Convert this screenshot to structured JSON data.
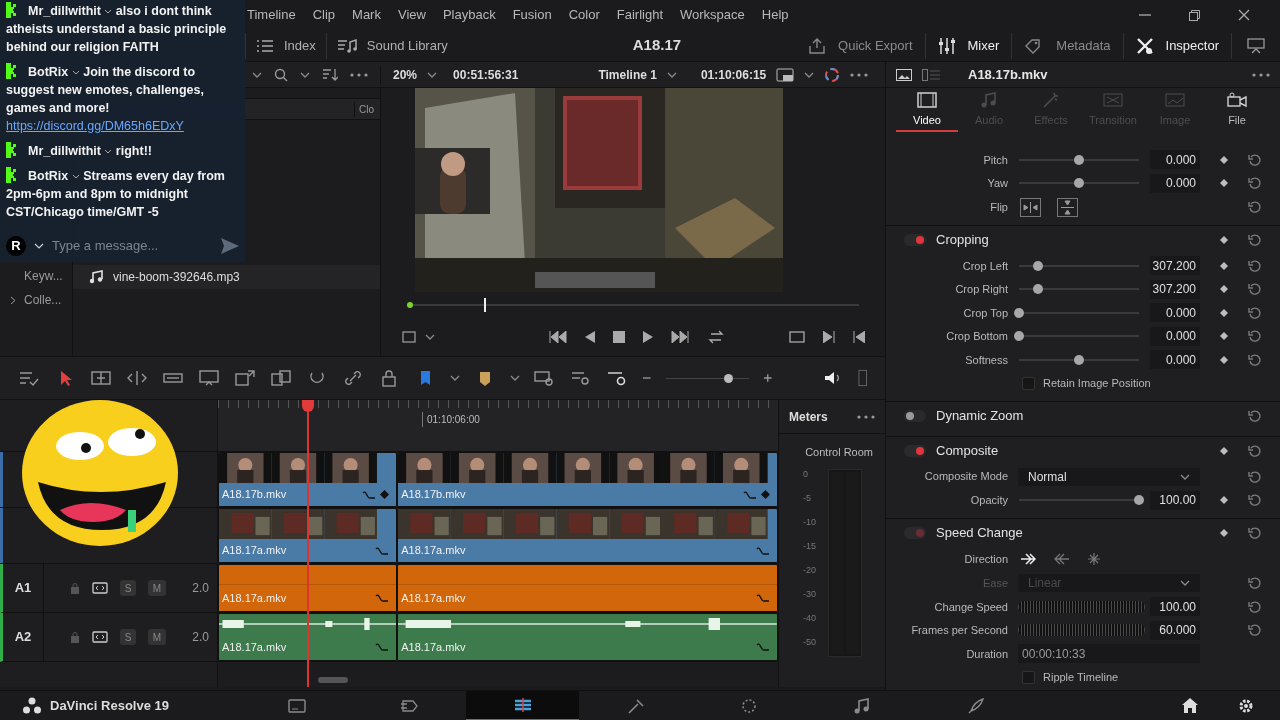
{
  "chat": {
    "messages": [
      {
        "user": "Mr_dillwithit",
        "text": "also i dont think atheists understand a basic principle behind our religion FAITH"
      },
      {
        "user": "BotRix",
        "text": "Join the discord to suggest new emotes, challenges, games and more!",
        "link": "https://discord.gg/DM65h6EDxY"
      },
      {
        "user": "Mr_dillwithit",
        "text": "right!!"
      },
      {
        "user": "BotRix",
        "text": "Streams every day from 2pm-6pm and 8pm to midnight CST/Chicago time/GMT -5"
      }
    ],
    "avatar": "R",
    "placeholder": "Type a message..."
  },
  "menu": [
    "Timeline",
    "Clip",
    "Mark",
    "View",
    "Playback",
    "Fusion",
    "Color",
    "Fairlight",
    "Workspace",
    "Help"
  ],
  "toolbar": {
    "left": [
      {
        "kind": "index",
        "label": "Index"
      },
      {
        "kind": "sound",
        "label": "Sound Library"
      }
    ],
    "project": "A18.17",
    "right": [
      {
        "kind": "export",
        "label": "Quick Export",
        "selected": false
      },
      {
        "kind": "mixer",
        "label": "Mixer",
        "selected": true
      },
      {
        "kind": "metadata",
        "label": "Metadata",
        "selected": false
      },
      {
        "kind": "inspector",
        "label": "Inspector",
        "selected": true
      }
    ]
  },
  "media_pool": {
    "column_header": "Clo",
    "items": [
      {
        "kind": "audio",
        "name": "vine-boom-392646.mp3"
      }
    ],
    "bins": [
      {
        "label": "Keyw...",
        "expandable": false
      },
      {
        "label": "Colle...",
        "expandable": true
      }
    ]
  },
  "viewer": {
    "zoom": "20%",
    "source_timecode": "00:51:56:31",
    "timeline": "Timeline 1",
    "timecode": "01:10:06:15",
    "level": 0.17
  },
  "inspector": {
    "clip": "A18.17b.mkv",
    "tabs": [
      {
        "label": "Video",
        "selected": true,
        "disabled": false
      },
      {
        "label": "Audio",
        "selected": false,
        "disabled": true
      },
      {
        "label": "Effects",
        "selected": false,
        "disabled": true
      },
      {
        "label": "Transition",
        "selected": false,
        "disabled": true
      },
      {
        "label": "Image",
        "selected": false,
        "disabled": true
      },
      {
        "label": "File",
        "selected": false,
        "disabled": false
      }
    ],
    "rows": [
      {
        "kind": "slider",
        "label": "Pitch",
        "level": 0.5,
        "value": "0.000",
        "keyframe": true
      },
      {
        "kind": "slider",
        "label": "Yaw",
        "level": 0.5,
        "value": "0.000",
        "keyframe": true
      },
      {
        "kind": "flip",
        "label": "Flip"
      },
      {
        "kind": "section",
        "label": "Cropping",
        "on": true,
        "disabled": false,
        "keyframe": true
      },
      {
        "kind": "slider",
        "label": "Crop Left",
        "level": 0.16,
        "value": "307.200",
        "keyframe": true
      },
      {
        "kind": "slider",
        "label": "Crop Right",
        "level": 0.16,
        "value": "307.200",
        "keyframe": true
      },
      {
        "kind": "slider",
        "label": "Crop Top",
        "level": 0,
        "value": "0.000",
        "keyframe": true
      },
      {
        "kind": "slider",
        "label": "Crop Bottom",
        "level": 0,
        "value": "0.000",
        "keyframe": true
      },
      {
        "kind": "slider",
        "label": "Softness",
        "level": 0.5,
        "value": "0.000",
        "keyframe": true
      },
      {
        "kind": "checkbox",
        "label": "Retain Image Position",
        "checked": false
      },
      {
        "kind": "section",
        "label": "Dynamic Zoom",
        "on": false,
        "disabled": false,
        "keyframe": false
      },
      {
        "kind": "section",
        "label": "Composite",
        "on": true,
        "disabled": false,
        "keyframe": true
      },
      {
        "kind": "dropdown",
        "label": "Composite Mode",
        "value": "Normal",
        "disabled": false
      },
      {
        "kind": "slider",
        "label": "Opacity",
        "level": 1,
        "value": "100.00",
        "keyframe": true
      },
      {
        "kind": "section",
        "label": "Speed Change",
        "on": true,
        "disabled": true,
        "keyframe": true
      },
      {
        "kind": "direction",
        "label": "Direction"
      },
      {
        "kind": "dropdown",
        "label": "Ease",
        "value": "Linear",
        "disabled": true
      },
      {
        "kind": "jog",
        "label": "Change Speed",
        "value": "100.00"
      },
      {
        "kind": "jog",
        "label": "Frames per Second",
        "value": "60.000"
      },
      {
        "kind": "field",
        "label": "Duration",
        "value": "00:00:10:33"
      },
      {
        "kind": "checkbox",
        "label": "Ripple Timeline",
        "checked": false
      }
    ]
  },
  "timeline": {
    "ruler": "01:10:06:00",
    "zoom": {
      "level": 0.75
    },
    "tracks": [
      {
        "kind": "video",
        "color": "#4a7aa6",
        "clips": [
          {
            "name": "A18.17b.mkv"
          },
          {
            "name": "A18.17b.mkv"
          }
        ]
      },
      {
        "kind": "video",
        "color": "#4a7aa6",
        "clips": [
          {
            "name": "A18.17a.mkv"
          },
          {
            "name": "A18.17a.mkv"
          }
        ]
      },
      {
        "kind": "audio",
        "name": "A1",
        "solo": "S",
        "mute": "M",
        "channels": "2.0",
        "color": "#d1660a",
        "clips": [
          {
            "name": "A18.17a.mkv"
          },
          {
            "name": "A18.17a.mkv"
          }
        ]
      },
      {
        "kind": "audio",
        "name": "A2",
        "solo": "S",
        "mute": "M",
        "channels": "2.0",
        "color": "#3d7a4c",
        "clips": [
          {
            "name": "A18.17a.mkv"
          },
          {
            "name": "A18.17a.mkv"
          }
        ]
      }
    ]
  },
  "meters": {
    "title": "Meters",
    "label": "Control Room",
    "scale": [
      "0",
      "-5",
      "-10",
      "-15",
      "-20",
      "-30",
      "-40",
      "-50"
    ]
  },
  "footer": {
    "app": "DaVinci Resolve 19",
    "pages": [
      {
        "kind": "media",
        "selected": false
      },
      {
        "kind": "cut",
        "selected": false
      },
      {
        "kind": "edit",
        "selected": true
      },
      {
        "kind": "fusion",
        "selected": false
      },
      {
        "kind": "color",
        "selected": false
      },
      {
        "kind": "fairlight",
        "selected": false
      },
      {
        "kind": "deliver",
        "selected": false
      }
    ]
  }
}
